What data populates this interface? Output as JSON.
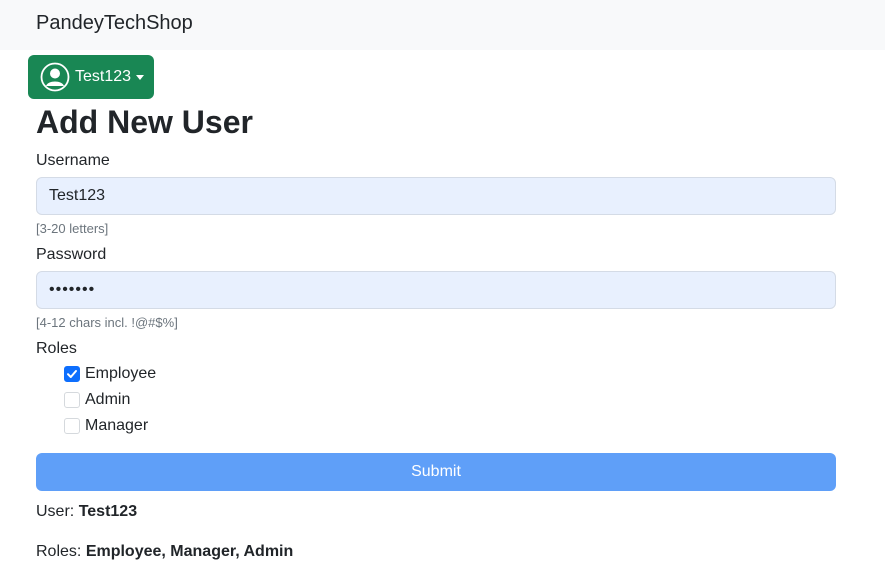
{
  "navbar": {
    "brand": "PandeyTechShop"
  },
  "user_menu": {
    "label": "Test123",
    "icon": "person-circle-icon"
  },
  "page": {
    "title": "Add New User"
  },
  "form": {
    "username": {
      "label": "Username",
      "value": "Test123",
      "hint": "[3-20 letters]"
    },
    "password": {
      "label": "Password",
      "value": "•••••••",
      "hint": "[4-12 chars incl. !@#$%]"
    },
    "roles": {
      "label": "Roles",
      "options": [
        {
          "label": "Employee",
          "checked": true
        },
        {
          "label": "Admin",
          "checked": false
        },
        {
          "label": "Manager",
          "checked": false
        }
      ]
    },
    "submit_label": "Submit"
  },
  "summary": {
    "user_prefix": "User:",
    "user_value": "Test123",
    "roles_prefix": "Roles:",
    "roles_value": "Employee, Manager, Admin"
  },
  "colors": {
    "navbar_bg": "#f8f9fa",
    "user_button": "#198754",
    "input_bg": "#e8f0fe",
    "checkbox_checked": "#0d6efd",
    "submit_button": "#5f9ff8"
  }
}
